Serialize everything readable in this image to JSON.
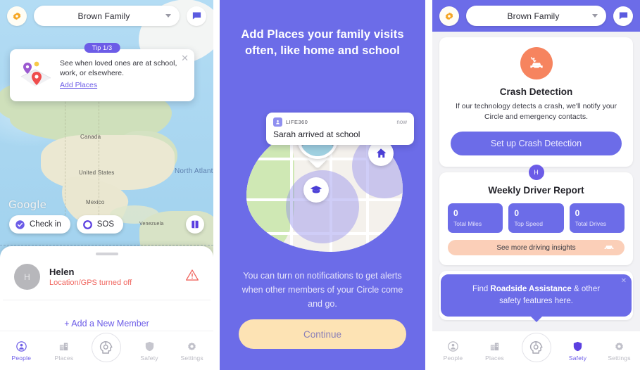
{
  "panel1": {
    "name": "map-people-screen",
    "header": {
      "gear_icon": "gear-icon",
      "family_name": "Brown Family",
      "chat_icon": "chat-icon"
    },
    "tip": {
      "badge": "Tip 1/3",
      "text": "See when loved ones are at school, work, or elsewhere.",
      "link": "Add Places",
      "close_icon": "close-icon",
      "art_icon": "map-pins-icon"
    },
    "map": {
      "labels": [
        "Canada",
        "United States",
        "Mexico",
        "Venezuela"
      ],
      "ocean_label": "North Atlantic Ocean",
      "watermark": "Google"
    },
    "actions": {
      "checkin_label": "Check in",
      "checkin_icon": "check-shield-icon",
      "sos_label": "SOS",
      "sos_icon": "sos-ring-icon",
      "layers_icon": "map-layers-icon"
    },
    "sheet": {
      "member": {
        "avatar_initial": "H",
        "name": "Helen",
        "status": "Location/GPS turned off",
        "alert_icon": "warning-triangle-icon"
      },
      "add_member_label": "+ Add a New Member"
    },
    "nav": {
      "items": [
        {
          "label": "People",
          "icon": "person-circle-icon",
          "active": true
        },
        {
          "label": "Places",
          "icon": "buildings-icon",
          "active": false
        },
        {
          "label": "Safety",
          "icon": "shield-icon",
          "active": false
        },
        {
          "label": "Settings",
          "icon": "gear-icon",
          "active": false
        }
      ],
      "center_icon": "driving-head-icon"
    }
  },
  "panel2": {
    "name": "add-places-onboarding-screen",
    "title": "Add Places your family visits often, like home and school",
    "notification": {
      "app_name": "LIFE360",
      "app_icon": "life360-app-icon",
      "time": "now",
      "message": "Sarah arrived at school"
    },
    "hero": {
      "avatar_pin_icon": "person-photo-pin-icon",
      "home_icon": "home-icon",
      "school_icon": "graduation-cap-icon"
    },
    "subtitle": "You can turn on notifications to get alerts when other members of your Circle come and go.",
    "continue_label": "Continue"
  },
  "panel3": {
    "name": "safety-screen",
    "header": {
      "gear_icon": "gear-icon",
      "family_name": "Brown Family",
      "chat_icon": "chat-icon"
    },
    "crash": {
      "icon": "crash-car-icon",
      "title": "Crash Detection",
      "description": "If our technology detects a crash, we'll notify your Circle and emergency contacts.",
      "button_label": "Set up Crash Detection"
    },
    "weekly_report": {
      "avatar_initial": "H",
      "title": "Weekly Driver Report",
      "stats": [
        {
          "value": "0",
          "label": "Total Miles"
        },
        {
          "value": "0",
          "label": "Top Speed"
        },
        {
          "value": "0",
          "label": "Total Drives"
        }
      ],
      "insights_label": "See more driving insights",
      "insights_icon": "car-icon"
    },
    "roadside_tip": {
      "prefix": "Find ",
      "bold": "Roadside Assistance",
      "suffix": " & other",
      "line2": "safety features here.",
      "close_icon": "close-icon"
    },
    "nav": {
      "items": [
        {
          "label": "People",
          "icon": "person-circle-icon",
          "active": false
        },
        {
          "label": "Places",
          "icon": "buildings-icon",
          "active": false
        },
        {
          "label": "Safety",
          "icon": "shield-icon",
          "active": true
        },
        {
          "label": "Settings",
          "icon": "gear-icon",
          "active": false
        }
      ],
      "center_icon": "driving-head-icon"
    }
  },
  "colors": {
    "brand_purple": "#6c5ce7",
    "panel_purple": "#6c6ce8",
    "accent_cream": "#fde3b4",
    "accent_peach": "#fbcfb8",
    "crash_orange": "#f6845f",
    "alert_red": "#f0665f",
    "map_water": "#a9d8f2"
  }
}
